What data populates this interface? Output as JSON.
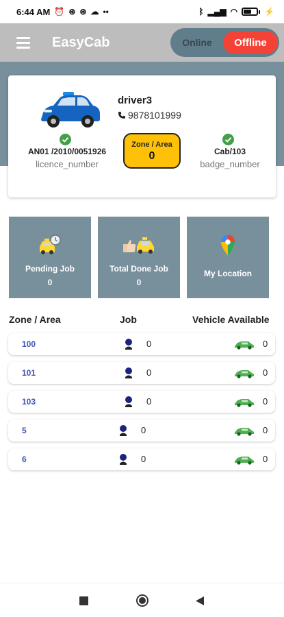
{
  "status_bar": {
    "time": "6:44 AM",
    "battery": "60"
  },
  "app": {
    "title": "EasyCab"
  },
  "availability": {
    "online_label": "Online",
    "offline_label": "Offline"
  },
  "driver": {
    "name": "driver3",
    "phone": "9878101999",
    "licence_number": "AN01 /2010/0051926",
    "licence_label": "licence_number",
    "badge_number": "Cab/103",
    "badge_label": "badge_number",
    "zone_label": "Zone / Area",
    "zone_value": "0"
  },
  "tiles": [
    {
      "label": "Pending Job",
      "value": "0",
      "icon": "pending-taxi-icon"
    },
    {
      "label": "Total Done Job",
      "value": "0",
      "icon": "thumbs-up-taxi-icon"
    },
    {
      "label": "My Location",
      "icon": "map-pin-icon"
    }
  ],
  "table": {
    "headers": {
      "zone": "Zone / Area",
      "job": "Job",
      "vehicle": "Vehicle Available"
    },
    "rows": [
      {
        "zone": "100",
        "job": "0",
        "vehicles": "0"
      },
      {
        "zone": "101",
        "job": "0",
        "vehicles": "0"
      },
      {
        "zone": "103",
        "job": "0",
        "vehicles": "0"
      },
      {
        "zone": "5",
        "job": "0",
        "vehicles": "0"
      },
      {
        "zone": "6",
        "job": "0",
        "vehicles": "0"
      }
    ]
  },
  "colors": {
    "app_bar": "#bdbdbd",
    "band": "#78909c",
    "offline": "#f44336",
    "zone_box": "#ffc107",
    "zone_link": "#3f51b5",
    "check": "#43a047",
    "vehicle_icon": "#4caf50"
  }
}
